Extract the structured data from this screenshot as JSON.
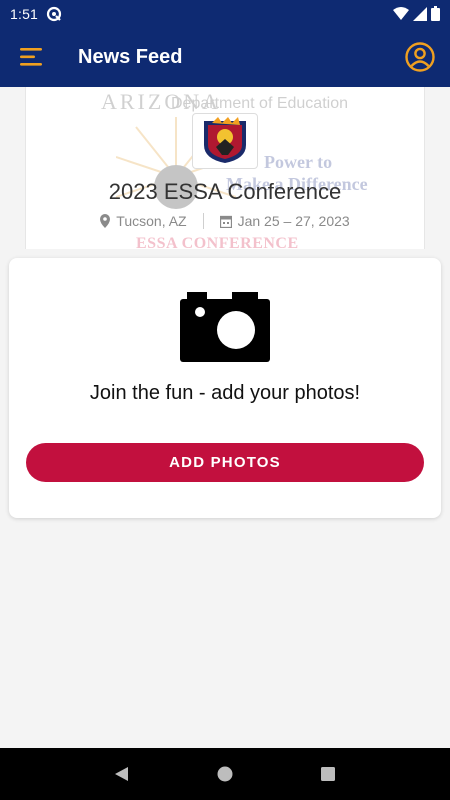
{
  "status_bar": {
    "time": "1:51",
    "icons": [
      "q-sync-icon",
      "wifi-icon",
      "signal-icon",
      "battery-icon"
    ]
  },
  "app_bar": {
    "title": "News Feed",
    "left_icon": "menu-icon",
    "right_icon": "account-icon",
    "accent_color": "#f0a020",
    "background_color": "#0e2a72"
  },
  "event": {
    "title": "2023 ESSA Conference",
    "location": "Tucson, AZ",
    "dates": "Jan 25 – 27, 2023",
    "banner": {
      "az_title": "ARIZONA",
      "dept": "Department of Education",
      "power": "Power to",
      "make": "Make a Difference",
      "essa": "ESSA CONFERENCE"
    }
  },
  "photos_card": {
    "prompt": "Join the fun - add your photos!",
    "button_label": "ADD PHOTOS",
    "button_color": "#c2103e"
  },
  "nav_bar": {
    "icons": [
      "back-icon",
      "home-icon",
      "recents-icon"
    ]
  }
}
